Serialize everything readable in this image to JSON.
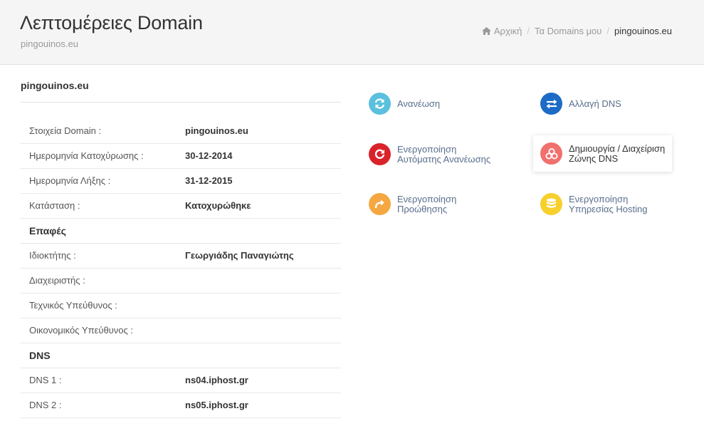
{
  "header": {
    "title": "Λεπτομέρειες Domain",
    "subtitle": "pingouinos.eu"
  },
  "breadcrumb": {
    "home": "Αρχική",
    "my_domains": "Τα Domains μου",
    "current": "pingouinos.eu"
  },
  "domain_heading": "pingouinos.eu",
  "details": {
    "domain_info": {
      "label": "Στοιχεία Domain :",
      "value": "pingouinos.eu"
    },
    "registration_date": {
      "label": "Ημερομηνία Κατοχύρωσης :",
      "value": "30-12-2014"
    },
    "expiry_date": {
      "label": "Ημερομηνία Λήξης :",
      "value": "31-12-2015"
    },
    "status": {
      "label": "Κατάσταση :",
      "value": "Κατοχυρώθηκε"
    }
  },
  "contacts": {
    "section_title": "Επαφές",
    "owner": {
      "label": "Ιδιοκτήτης :",
      "value": "Γεωργιάδης Παναγιώτης"
    },
    "admin": {
      "label": "Διαχειριστής :",
      "value": ""
    },
    "technical": {
      "label": "Τεχνικός Υπεύθυνος :",
      "value": ""
    },
    "billing": {
      "label": "Οικονομικός Υπεύθυνος :",
      "value": ""
    }
  },
  "dns": {
    "section_title": "DNS",
    "dns1": {
      "label": "DNS 1 :",
      "value": "ns04.iphost.gr"
    },
    "dns2": {
      "label": "DNS 2 :",
      "value": "ns05.iphost.gr"
    }
  },
  "actions": {
    "renew": {
      "line1": "Ανανέωση",
      "line2": "",
      "icon": "refresh-icon",
      "color": "#5bc0de"
    },
    "change_dns": {
      "line1": "Αλλαγή DNS",
      "line2": "",
      "icon": "exchange-icon",
      "color": "#1e6bc6"
    },
    "auto_renew": {
      "line1": "Ενεργοποίηση",
      "line2": "Αυτόματης Ανανέωσης",
      "icon": "power-refresh-icon",
      "color": "#d9232a"
    },
    "dns_zone": {
      "line1": "Δημιουργία / Διαχείριση",
      "line2": "Ζώνης DNS",
      "icon": "cubes-icon",
      "color": "#f0706e"
    },
    "forwarding": {
      "line1": "Ενεργοποίηση",
      "line2": "Προώθησης",
      "icon": "share-arrow-icon",
      "color": "#f5a742"
    },
    "hosting": {
      "line1": "Ενεργοποίηση",
      "line2": "Υπηρεσίας Hosting",
      "icon": "database-icon",
      "color": "#f7d02e"
    }
  }
}
